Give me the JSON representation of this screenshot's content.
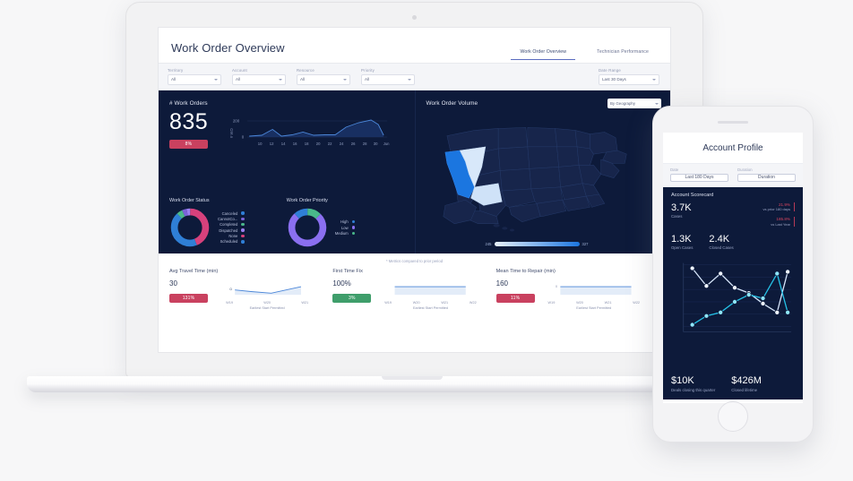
{
  "device": {
    "laptop_name": "laptop-mockup",
    "phone_name": "phone-mockup"
  },
  "dashboard": {
    "title": "Work Order Overview",
    "tabs": [
      {
        "label": "Work Order Overview",
        "active": true
      },
      {
        "label": "Technician Performance",
        "active": false
      }
    ],
    "filters": [
      {
        "label": "Territory",
        "value": "All"
      },
      {
        "label": "Account",
        "value": "All"
      },
      {
        "label": "Resource",
        "value": "All"
      },
      {
        "label": "Priority",
        "value": "All"
      }
    ],
    "date_range": {
      "label": "Date Range",
      "value": "Last 30 Days"
    },
    "work_orders": {
      "title": "# Work Orders",
      "value": "835",
      "badge": "8%",
      "badge_color": "#c9415f"
    },
    "status_chart": {
      "title": "Work Order Status",
      "legend": [
        {
          "label": "Canceled",
          "color": "#2f7fd6"
        },
        {
          "label": "CannotCo...",
          "color": "#7a63d8"
        },
        {
          "label": "Completed",
          "color": "#49b88a"
        },
        {
          "label": "Dispatched",
          "color": "#9a7ff0"
        },
        {
          "label": "None",
          "color": "#d6417c"
        },
        {
          "label": "Scheduled",
          "color": "#2f7fd6"
        }
      ]
    },
    "priority_chart": {
      "title": "Work Order Priority",
      "legend": [
        {
          "label": "High",
          "color": "#2f7fd6"
        },
        {
          "label": "Low",
          "color": "#8a6ff0"
        },
        {
          "label": "Medium",
          "color": "#49b88a"
        }
      ]
    },
    "map": {
      "title": "Work Order Volume",
      "select_value": "By Geography",
      "legend_min": "245",
      "legend_max": "327"
    },
    "note": "* Metrics compared to prior period",
    "metrics": [
      {
        "title": "Avg Travel Time (min)",
        "value": "30",
        "badge": "131%",
        "badge_color": "#c9415f",
        "axis_caption": "Earliest Start Permitted",
        "ticks": [
          "W19",
          "W20",
          "W21"
        ]
      },
      {
        "title": "First Time Fix",
        "value": "100%",
        "badge": "3%",
        "badge_color": "#3f9e6b",
        "axis_caption": "Earliest Start Permitted",
        "ticks": [
          "W19",
          "W20",
          "W21",
          "W22"
        ]
      },
      {
        "title": "Mean Time to Repair (min)",
        "value": "160",
        "badge": "11%",
        "badge_color": "#c9415f",
        "axis_caption": "Earliest Start Permitted",
        "ticks": [
          "W19",
          "W20",
          "W21",
          "W22"
        ]
      }
    ]
  },
  "phone": {
    "title": "Account Profile",
    "filters": [
      {
        "label": "Date",
        "value": "Last 180 Days"
      },
      {
        "label": "Duration",
        "value": "Duration"
      }
    ],
    "scorecard": {
      "title": "Account Scorecard",
      "primary": {
        "value": "3.7K",
        "caption": "Cases"
      },
      "comparisons": [
        {
          "pct": "21.9%",
          "caption": "vs prior 180 days"
        },
        {
          "pct": "185.8%",
          "caption": "vs Last Year"
        }
      ],
      "pair": [
        {
          "value": "1.3K",
          "caption": "Open Cases"
        },
        {
          "value": "2.4K",
          "caption": "Closed Cases"
        }
      ],
      "footer": [
        {
          "value": "$10K",
          "caption": "Deals closing this quarter"
        },
        {
          "value": "$426M",
          "caption": "Closed lifetime"
        }
      ]
    }
  },
  "chart_data": [
    {
      "type": "area",
      "name": "work-orders-sparkline",
      "title": "# Work Orders",
      "ylabel": "# WO",
      "x": [
        "10",
        "12",
        "14",
        "16",
        "18",
        "20",
        "22",
        "24",
        "26",
        "28",
        "30",
        "Jun"
      ],
      "values": [
        18,
        70,
        20,
        35,
        22,
        30,
        28,
        32,
        95,
        160,
        212,
        70
      ],
      "ylim": [
        0,
        240
      ],
      "yticks": [
        "0",
        "200"
      ],
      "color": "#3f7fd0"
    },
    {
      "type": "pie",
      "name": "work-order-status-donut",
      "title": "Work Order Status",
      "categories": [
        "Canceled",
        "CannotCo...",
        "Completed",
        "Dispatched",
        "None",
        "Scheduled"
      ],
      "values": [
        3,
        2,
        5,
        2,
        44,
        44
      ],
      "colors": [
        "#2f7fd6",
        "#7a63d8",
        "#49b88a",
        "#9a7ff0",
        "#d6417c",
        "#2f7fd6"
      ],
      "legend": "right"
    },
    {
      "type": "pie",
      "name": "work-order-priority-donut",
      "title": "Work Order Priority",
      "categories": [
        "High",
        "Low",
        "Medium"
      ],
      "values": [
        12,
        76,
        12
      ],
      "colors": [
        "#2f7fd6",
        "#8a6ff0",
        "#49b88a"
      ],
      "legend": "right"
    },
    {
      "type": "heatmap",
      "name": "work-order-volume-map",
      "title": "Work Order Volume",
      "regions": [
        {
          "name": "California",
          "value": 327
        },
        {
          "name": "Nevada",
          "value": 262
        },
        {
          "name": "Arizona",
          "value": 268
        }
      ],
      "scale_min": 245,
      "scale_max": 327,
      "colors": [
        "#e8f1fc",
        "#1b76e0"
      ]
    },
    {
      "type": "line",
      "name": "avg-travel-time-sparkline",
      "title": "Avg Travel Time (min)",
      "xlabel": "Earliest Start Permitted",
      "x": [
        "W19",
        "W20",
        "W21"
      ],
      "values": [
        30,
        18,
        42
      ],
      "color": "#3f7fd0"
    },
    {
      "type": "line",
      "name": "first-time-fix-sparkline",
      "title": "First Time Fix",
      "xlabel": "Earliest Start Permitted",
      "x": [
        "W19",
        "W20",
        "W21",
        "W22"
      ],
      "values": [
        100,
        100,
        100,
        100
      ],
      "color": "#3f7fd0"
    },
    {
      "type": "line",
      "name": "mean-time-repair-sparkline",
      "title": "Mean Time to Repair (min)",
      "xlabel": "Earliest Start Permitted",
      "x": [
        "W19",
        "W20",
        "W21",
        "W22"
      ],
      "values": [
        160,
        160,
        160,
        160
      ],
      "color": "#3f7fd0"
    },
    {
      "type": "line",
      "name": "account-cases-trend",
      "title": "Account Scorecard trend",
      "series": [
        {
          "name": "Open Cases",
          "values": [
            88,
            58,
            80,
            62,
            55,
            40,
            28,
            95
          ],
          "color": "#eef5ff"
        },
        {
          "name": "Closed Cases",
          "values": [
            8,
            25,
            32,
            48,
            58,
            55,
            88,
            30
          ],
          "color": "#25c3e8"
        }
      ],
      "x": [
        "1",
        "2",
        "3",
        "4",
        "5",
        "6",
        "7",
        "8"
      ]
    }
  ]
}
